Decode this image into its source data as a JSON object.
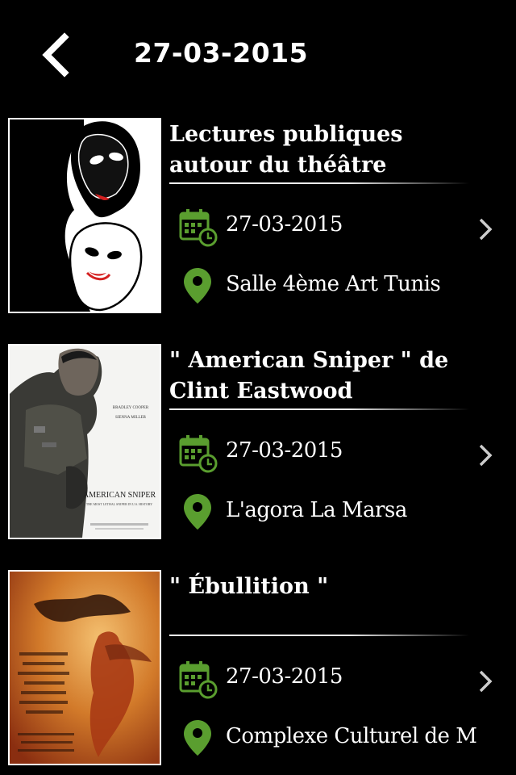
{
  "header": {
    "title": "27-03-2015",
    "back_icon": "chevron-left-icon"
  },
  "colors": {
    "background": "#000000",
    "text": "#ffffff",
    "accent_green": "#5a9e2f"
  },
  "events": [
    {
      "title_line1": "Lectures publiques",
      "title_line2": "autour du théâtre",
      "date": "27-03-2015",
      "venue": "Salle 4ème Art Tunis",
      "poster": "theatre-masks-image",
      "date_icon": "calendar-clock-icon",
      "venue_icon": "location-pin-icon",
      "action_icon": "chevron-right-icon"
    },
    {
      "title_line1": "\" American Sniper \" de",
      "title_line2": "Clint Eastwood",
      "date": "27-03-2015",
      "venue": "L'agora La Marsa",
      "poster": "american-sniper-poster-image",
      "poster_text_main": "AMERICAN SNIPER",
      "poster_text_sub": "THE MOST LETHAL SNIPER IN U.S. HISTORY",
      "poster_credit1": "BRADLEY COOPER",
      "poster_credit2": "SIENNA MILLER",
      "date_icon": "calendar-clock-icon",
      "venue_icon": "location-pin-icon",
      "action_icon": "chevron-right-icon"
    },
    {
      "title_line1": "\" Ébullition \"",
      "title_line2": "",
      "date": "27-03-2015",
      "venue": "Complexe Culturel de M",
      "poster": "ebullition-poster-image",
      "date_icon": "calendar-clock-icon",
      "venue_icon": "location-pin-icon",
      "action_icon": "chevron-right-icon"
    }
  ]
}
